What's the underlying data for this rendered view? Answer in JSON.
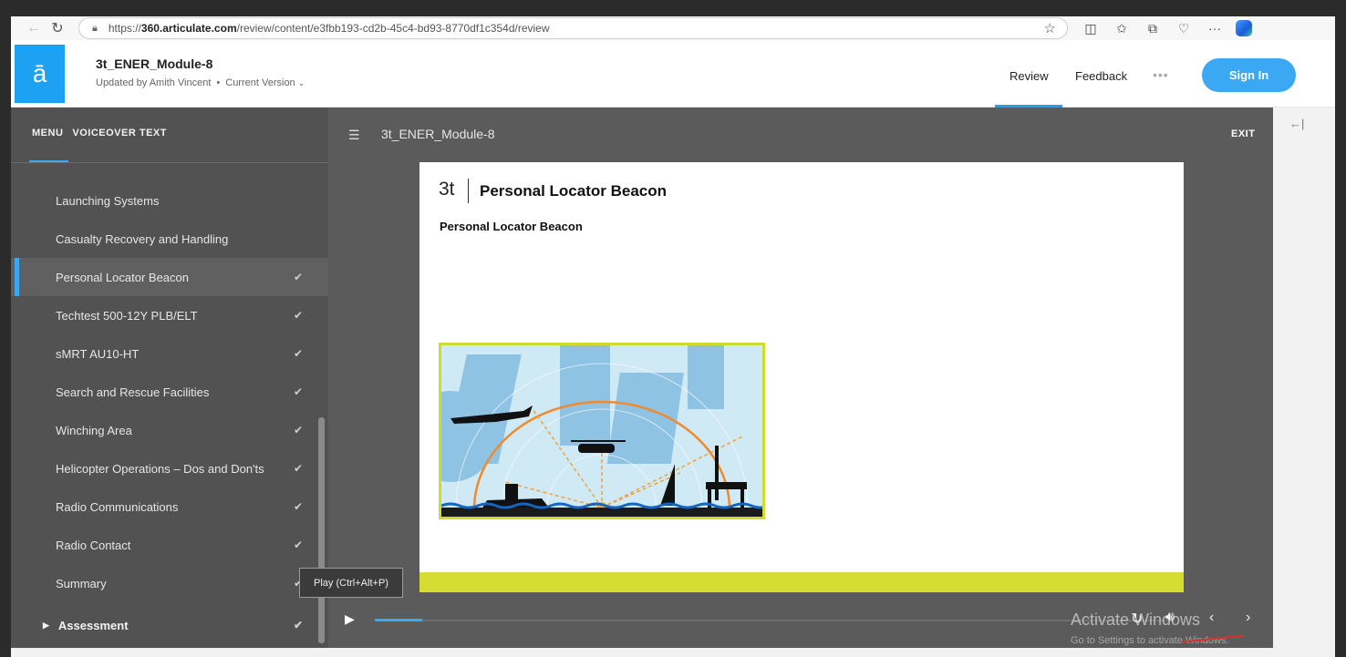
{
  "browser": {
    "url_prefix": "https://",
    "url_host": "360.articulate.com",
    "url_path": "/review/content/e3fbb193-cd2b-45c4-bd93-8770df1c354d/review",
    "icons": [
      "back-icon",
      "refresh-icon",
      "lock-icon",
      "favorite-star-icon",
      "split-screen-icon",
      "favorites-icon",
      "collections-icon",
      "browser-essentials-icon",
      "more-icon",
      "copilot-icon"
    ]
  },
  "header": {
    "logo": "ā",
    "title": "3t_ENER_Module-8",
    "updated_by": "Updated by Amith Vincent",
    "version": "Current Version",
    "nav_review": "Review",
    "nav_feedback": "Feedback",
    "nav_more": "•••",
    "sign_in": "Sign In"
  },
  "sidebar": {
    "tab_menu": "MENU",
    "tab_voiceover": "VOICEOVER TEXT",
    "items": [
      {
        "label": "Launching Systems",
        "check": ""
      },
      {
        "label": "Casualty Recovery and Handling",
        "check": ""
      },
      {
        "label": "Personal Locator Beacon",
        "check": "✔"
      },
      {
        "label": "Techtest 500-12Y PLB/ELT",
        "check": "✔"
      },
      {
        "label": "sMRT AU10-HT",
        "check": "✔"
      },
      {
        "label": "Search and Rescue Facilities",
        "check": "✔"
      },
      {
        "label": "Winching Area",
        "check": "✔"
      },
      {
        "label": "Helicopter Operations – Dos and Don'ts",
        "check": "✔"
      },
      {
        "label": "Radio Communications",
        "check": "✔"
      },
      {
        "label": "Radio Contact",
        "check": "✔"
      },
      {
        "label": "Summary",
        "check": "✔"
      }
    ],
    "active_index": 2,
    "assessment": "Assessment",
    "assessment_check": "✔"
  },
  "player": {
    "title": "3t_ENER_Module-8",
    "exit": "EXIT",
    "tooltip": "Play (Ctrl+Alt+P)",
    "progress": 0.06
  },
  "slide": {
    "logo_text": "3t",
    "title": "Personal Locator Beacon",
    "subtitle": "Personal Locator Beacon",
    "accent_color": "#d5dd33"
  },
  "overlay": {
    "watermark": "Activate Windows",
    "watermark_sub": "Go to Settings to activate Windows."
  },
  "colors": {
    "brand_blue": "#1da1f2",
    "player_bg": "#5b5b5b",
    "sidebar_bg": "#525252"
  }
}
